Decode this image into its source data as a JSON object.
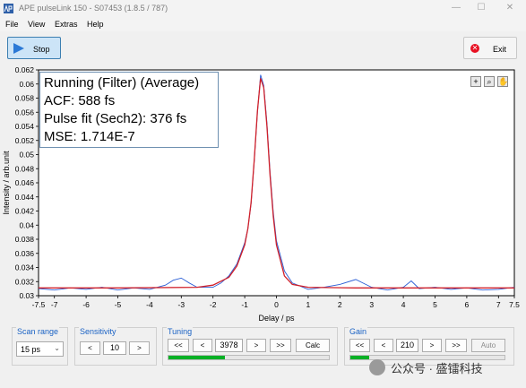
{
  "window": {
    "title": "APE pulseLink 150 - S07453 (1.8.5 / 787)",
    "minimize": "—",
    "maximize": "☐",
    "close": "✕"
  },
  "menu": [
    "File",
    "View",
    "Extras",
    "Help"
  ],
  "toolbar": {
    "stop_label": "Stop",
    "exit_label": "Exit"
  },
  "plot": {
    "status_lines": [
      "Running (Filter) (Average)",
      "ACF: 588 fs",
      "Pulse fit (Sech2): 376 fs",
      "MSE: 1.714E-7"
    ],
    "tools": [
      "+",
      "⌕",
      "✋"
    ]
  },
  "chart_data": {
    "type": "line",
    "xlabel": "Delay / ps",
    "ylabel": "Intensity / arb.unit",
    "xlim": [
      -7.5,
      7.5
    ],
    "ylim": [
      0.03,
      0.062
    ],
    "x_ticks": [
      "-7.5",
      "-7",
      "-6",
      "-5",
      "-4",
      "-3",
      "-2",
      "-1",
      "0",
      "1",
      "2",
      "3",
      "4",
      "5",
      "6",
      "7",
      "7.5"
    ],
    "y_ticks": [
      "0.062",
      "0.06",
      "0.058",
      "0.056",
      "0.054",
      "0.052",
      "0.05",
      "0.048",
      "0.046",
      "0.044",
      "0.042",
      "0.04",
      "0.038",
      "0.036",
      "0.034",
      "0.032",
      "0.03"
    ],
    "grid": false,
    "series": [
      {
        "color": "#2a5ed6",
        "x": [
          -7.5,
          -7.0,
          -6.5,
          -6.0,
          -5.5,
          -5.0,
          -4.5,
          -4.0,
          -3.5,
          -3.25,
          -3.0,
          -2.75,
          -2.5,
          -2.0,
          -1.75,
          -1.5,
          -1.25,
          -1.0,
          -0.9,
          -0.8,
          -0.7,
          -0.6,
          -0.5,
          -0.4,
          -0.3,
          -0.2,
          -0.1,
          0.0,
          0.25,
          0.5,
          1.0,
          1.5,
          2.0,
          2.5,
          3.0,
          3.5,
          4.0,
          4.25,
          4.5,
          5.0,
          5.5,
          6.0,
          6.5,
          7.0,
          7.5
        ],
        "y": [
          0.031,
          0.0308,
          0.0311,
          0.0309,
          0.0312,
          0.0308,
          0.0311,
          0.0309,
          0.0315,
          0.0322,
          0.0325,
          0.0318,
          0.0312,
          0.0312,
          0.0318,
          0.0328,
          0.0345,
          0.0375,
          0.0395,
          0.043,
          0.049,
          0.056,
          0.0613,
          0.0598,
          0.0545,
          0.0475,
          0.0418,
          0.0378,
          0.0335,
          0.0318,
          0.0309,
          0.0312,
          0.0316,
          0.0323,
          0.0312,
          0.0308,
          0.0312,
          0.0321,
          0.031,
          0.0312,
          0.0309,
          0.0311,
          0.0308,
          0.0309,
          0.0312
        ]
      },
      {
        "color": "#d0202a",
        "x": [
          -7.5,
          -5.0,
          -2.5,
          -2.0,
          -1.5,
          -1.25,
          -1.0,
          -0.9,
          -0.8,
          -0.7,
          -0.6,
          -0.5,
          -0.4,
          -0.3,
          -0.2,
          -0.1,
          0.0,
          0.25,
          0.5,
          1.0,
          2.5,
          5.0,
          7.5
        ],
        "y": [
          0.0311,
          0.0311,
          0.0312,
          0.0315,
          0.0326,
          0.0342,
          0.0372,
          0.0395,
          0.0432,
          0.0492,
          0.0562,
          0.0608,
          0.0595,
          0.054,
          0.047,
          0.0412,
          0.0372,
          0.0328,
          0.0316,
          0.0312,
          0.0311,
          0.0311,
          0.0311
        ]
      }
    ]
  },
  "scan_range": {
    "title": "Scan range",
    "value": "15 ps"
  },
  "sensitivity": {
    "title": "Sensitivity",
    "dec": "<",
    "value": "10",
    "inc": ">"
  },
  "tuning": {
    "title": "Tuning",
    "fast_back": "<<",
    "back": "<",
    "value": "3978",
    "fwd": ">",
    "fast_fwd": ">>",
    "calc": "Calc",
    "progress": 0.35
  },
  "gain": {
    "title": "Gain",
    "fast_back": "<<",
    "back": "<",
    "value": "210",
    "fwd": ">",
    "fast_fwd": ">>",
    "auto": "Auto",
    "progress": 0.12
  },
  "watermark": "公众号 · 盛镭科技"
}
